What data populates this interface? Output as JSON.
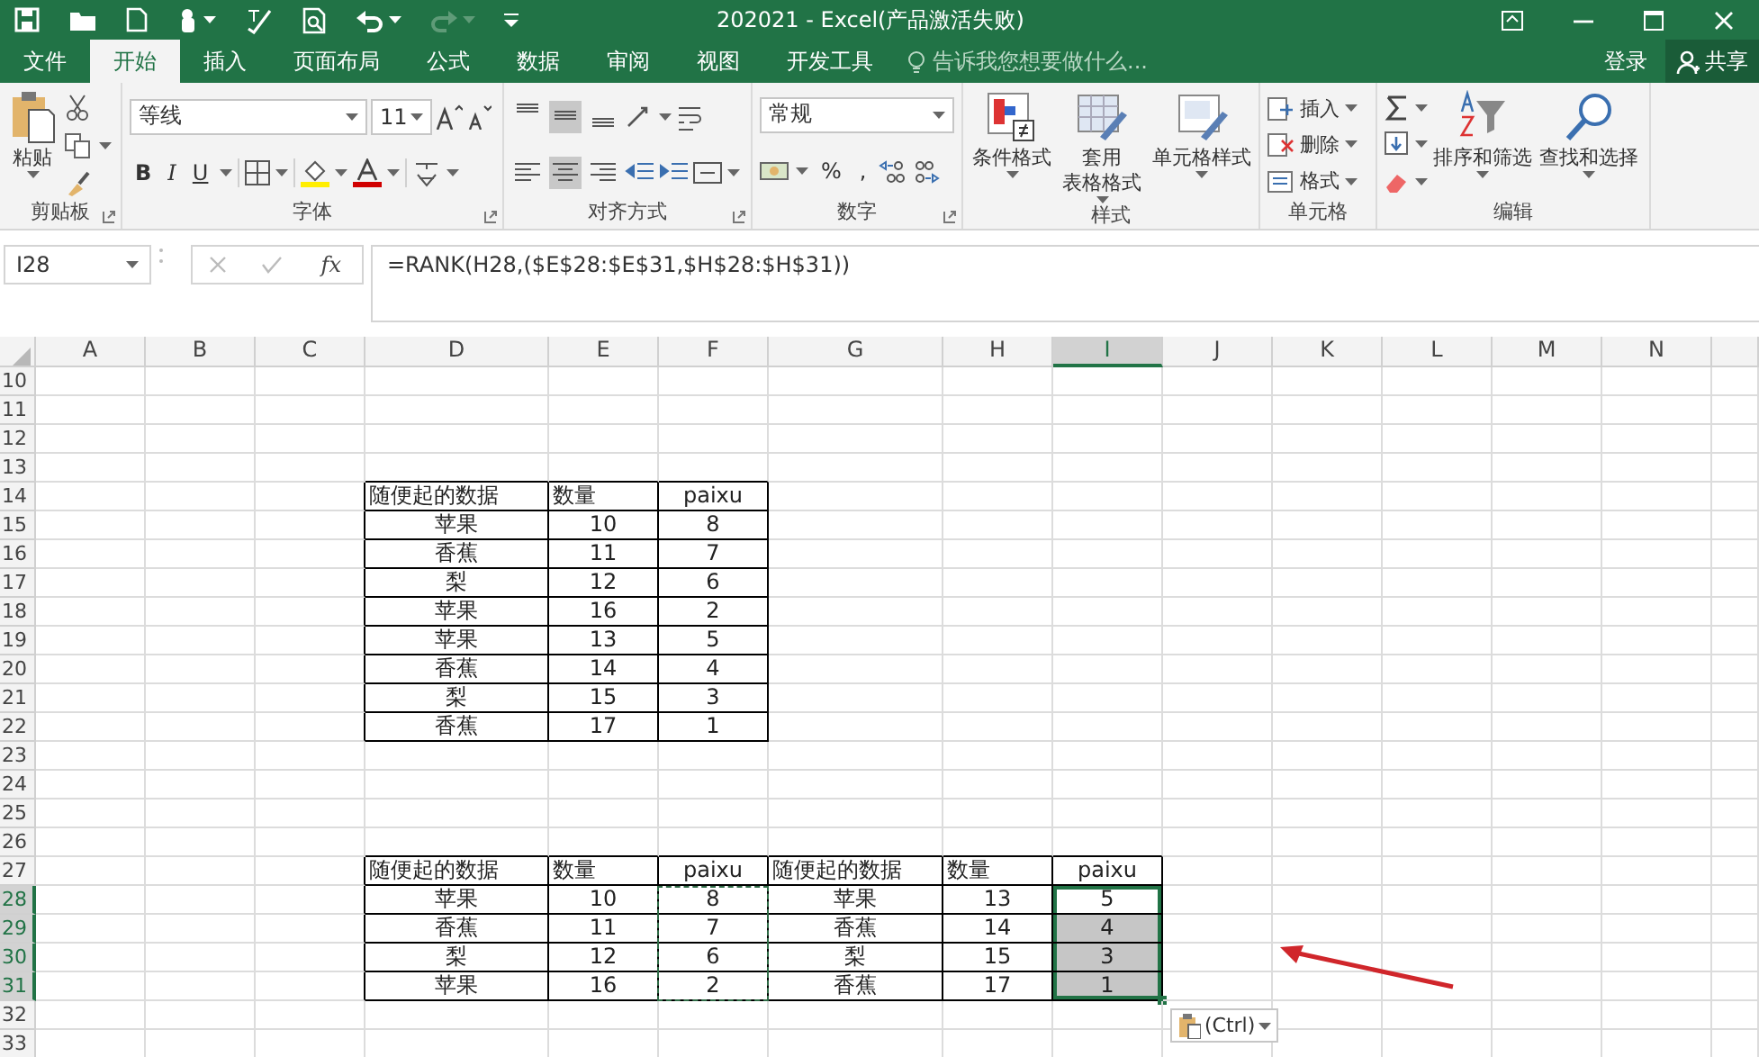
{
  "window": {
    "title": "202021 - Excel(产品激活失败)"
  },
  "menu_tabs": [
    {
      "label": "文件",
      "selected": false
    },
    {
      "label": "开始",
      "selected": true
    },
    {
      "label": "插入",
      "selected": false
    },
    {
      "label": "页面布局",
      "selected": false
    },
    {
      "label": "公式",
      "selected": false
    },
    {
      "label": "数据",
      "selected": false
    },
    {
      "label": "审阅",
      "selected": false
    },
    {
      "label": "视图",
      "selected": false
    },
    {
      "label": "开发工具",
      "selected": false
    }
  ],
  "tell_me": {
    "placeholder": "告诉我您想要做什么..."
  },
  "account": {
    "sign_in": "登录",
    "share": "共享"
  },
  "ribbon": {
    "clipboard": {
      "label": "剪贴板",
      "paste": "粘贴"
    },
    "font": {
      "label": "字体",
      "font_name": "等线",
      "font_size": "11",
      "bold": "B",
      "italic": "I",
      "underline": "U"
    },
    "alignment": {
      "label": "对齐方式",
      "vertical": [
        {
          "selected": false
        },
        {
          "selected": true
        },
        {
          "selected": false
        }
      ],
      "horizontal": [
        {
          "selected": false
        },
        {
          "selected": true
        },
        {
          "selected": false
        }
      ]
    },
    "number": {
      "label": "数字",
      "format": "常规",
      "percent": "%",
      "comma": ","
    },
    "styles": {
      "label": "样式",
      "buttons": [
        {
          "lines": [
            "条件格式"
          ]
        },
        {
          "lines": [
            "套用",
            "表格格式"
          ]
        },
        {
          "lines": [
            "单元格样式"
          ]
        }
      ]
    },
    "cells": {
      "label": "单元格",
      "buttons": [
        "插入",
        "删除",
        "格式"
      ]
    },
    "editing": {
      "label": "编辑",
      "buttons": [
        "排序和筛选",
        "查找和选择"
      ]
    }
  },
  "formula_bar": {
    "name_box": "I28",
    "function_button": "fx",
    "formula": "=RANK(H28,($E$28:$E$31,$H$28:$H$31))"
  },
  "sheet": {
    "columns": [
      {
        "label": "A",
        "selected": false
      },
      {
        "label": "B",
        "selected": false
      },
      {
        "label": "C",
        "selected": false
      },
      {
        "label": "D",
        "selected": false
      },
      {
        "label": "E",
        "selected": false
      },
      {
        "label": "F",
        "selected": false
      },
      {
        "label": "G",
        "selected": false
      },
      {
        "label": "H",
        "selected": false
      },
      {
        "label": "I",
        "selected": true
      },
      {
        "label": "J",
        "selected": false
      },
      {
        "label": "K",
        "selected": false
      },
      {
        "label": "L",
        "selected": false
      },
      {
        "label": "M",
        "selected": false
      },
      {
        "label": "N",
        "selected": false
      }
    ],
    "rows": [
      {
        "label": "10",
        "selected": false
      },
      {
        "label": "11",
        "selected": false
      },
      {
        "label": "12",
        "selected": false
      },
      {
        "label": "13",
        "selected": false
      },
      {
        "label": "14",
        "selected": false
      },
      {
        "label": "15",
        "selected": false
      },
      {
        "label": "16",
        "selected": false
      },
      {
        "label": "17",
        "selected": false
      },
      {
        "label": "18",
        "selected": false
      },
      {
        "label": "19",
        "selected": false
      },
      {
        "label": "20",
        "selected": false
      },
      {
        "label": "21",
        "selected": false
      },
      {
        "label": "22",
        "selected": false
      },
      {
        "label": "23",
        "selected": false
      },
      {
        "label": "24",
        "selected": false
      },
      {
        "label": "25",
        "selected": false
      },
      {
        "label": "26",
        "selected": false
      },
      {
        "label": "27",
        "selected": false
      },
      {
        "label": "28",
        "selected": true
      },
      {
        "label": "29",
        "selected": true
      },
      {
        "label": "30",
        "selected": true
      },
      {
        "label": "31",
        "selected": true
      },
      {
        "label": "32",
        "selected": false
      },
      {
        "label": "33",
        "selected": false
      }
    ],
    "tables": [
      {
        "columns": [
          {
            "header": "随便起的数据",
            "copied": false,
            "selected": false
          },
          {
            "header": "数量",
            "copied": false,
            "selected": false
          },
          {
            "header": "paixu",
            "copied": false,
            "selected": false
          }
        ],
        "rows": [
          [
            "苹果",
            "10",
            "8"
          ],
          [
            "香蕉",
            "11",
            "7"
          ],
          [
            "梨",
            "12",
            "6"
          ],
          [
            "苹果",
            "16",
            "2"
          ],
          [
            "苹果",
            "13",
            "5"
          ],
          [
            "香蕉",
            "14",
            "4"
          ],
          [
            "梨",
            "15",
            "3"
          ],
          [
            "香蕉",
            "17",
            "1"
          ]
        ]
      },
      {
        "columns": [
          {
            "header": "随便起的数据",
            "copied": false,
            "selected": false
          },
          {
            "header": "数量",
            "copied": false,
            "selected": false
          },
          {
            "header": "paixu",
            "copied": true,
            "selected": false
          }
        ],
        "rows": [
          [
            "苹果",
            "10",
            "8"
          ],
          [
            "香蕉",
            "11",
            "7"
          ],
          [
            "梨",
            "12",
            "6"
          ],
          [
            "苹果",
            "16",
            "2"
          ]
        ]
      },
      {
        "columns": [
          {
            "header": "随便起的数据",
            "copied": false,
            "selected": false
          },
          {
            "header": "数量",
            "copied": false,
            "selected": false
          },
          {
            "header": "paixu",
            "copied": false,
            "selected": true
          }
        ],
        "rows": [
          [
            "苹果",
            "13",
            "5"
          ],
          [
            "香蕉",
            "14",
            "4"
          ],
          [
            "梨",
            "15",
            "3"
          ],
          [
            "香蕉",
            "17",
            "1"
          ]
        ]
      }
    ]
  },
  "paste_options": {
    "label": "(Ctrl)"
  }
}
